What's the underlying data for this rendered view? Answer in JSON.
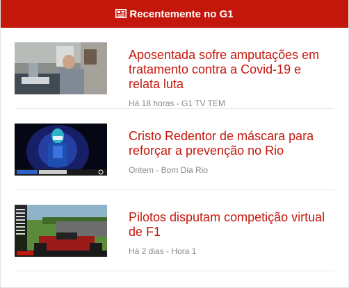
{
  "header": {
    "title": "Recentemente no G1",
    "icon": "newspaper-icon",
    "background": "#c4170c"
  },
  "items": [
    {
      "title": "Aposentada sofre amputações em tratamento contra a Covid-19 e relata luta",
      "meta": "Há 18 horas - G1 TV TEM",
      "thumb_icon": "hospital-scene-image"
    },
    {
      "title": "Cristo Redentor de máscara para reforçar a prevenção no Rio",
      "meta": "Ontem - Bom Dia Rio",
      "thumb_icon": "cristo-redentor-image"
    },
    {
      "title": "Pilotos disputam competição virtual de F1",
      "meta": "Há 2 dias - Hora 1",
      "thumb_icon": "f1-game-image"
    }
  ],
  "colors": {
    "title": "#c4170c",
    "meta": "#888888"
  }
}
